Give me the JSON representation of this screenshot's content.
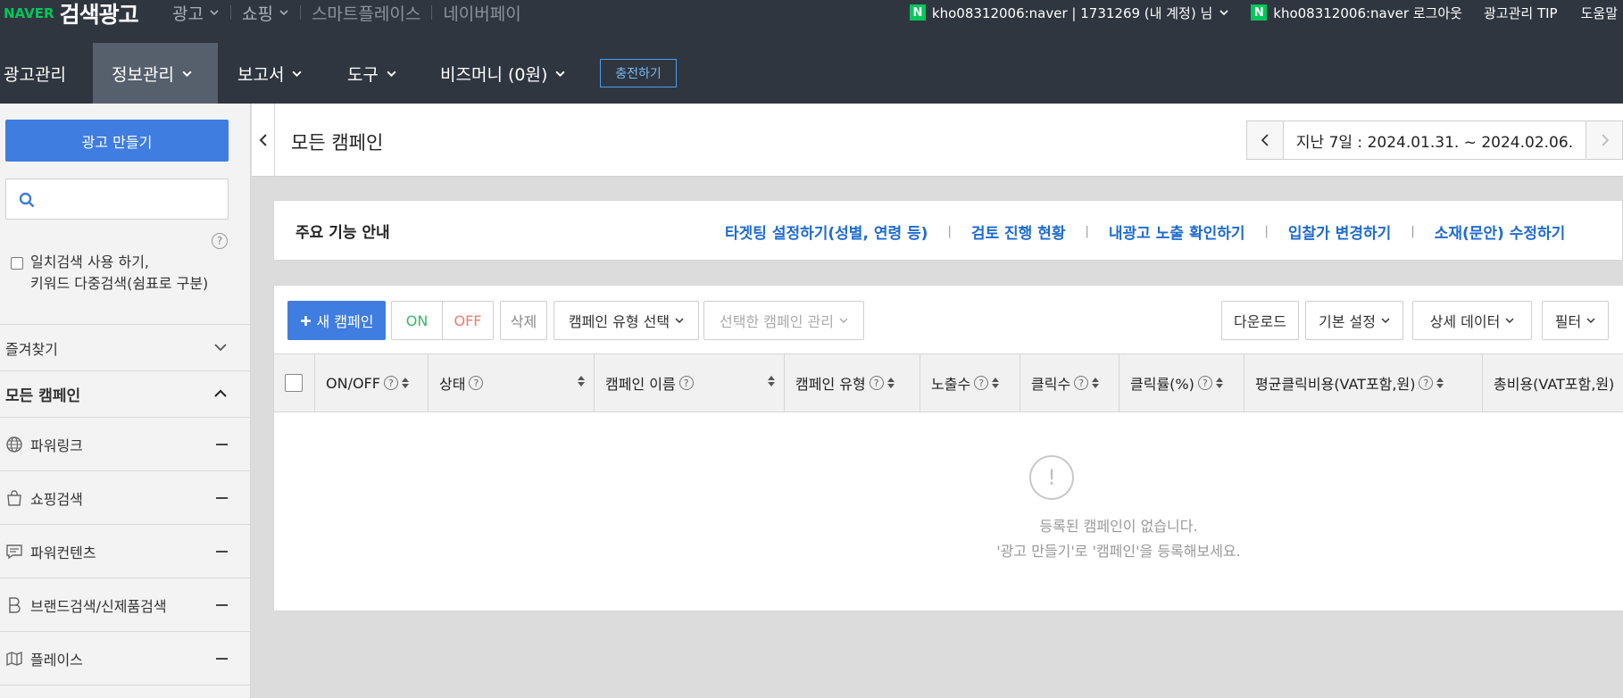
{
  "header": {
    "logo_naver": "NAVER",
    "logo_title": "검색광고",
    "nav": [
      {
        "label": "광고"
      },
      {
        "label": "쇼핑"
      },
      {
        "label": "스마트플레이스"
      },
      {
        "label": "네이버페이"
      }
    ],
    "account_label": "kho08312006:naver | 1731269 (내 계정) 님",
    "logout_label": "kho08312006:naver 로그아웃",
    "tip_label": "광고관리 TIP",
    "help_label": "도움말",
    "n_badge": "N",
    "brand_color": "#03c75a"
  },
  "secondnav": {
    "items": [
      {
        "label": "광고관리"
      },
      {
        "label": "정보관리"
      },
      {
        "label": "보고서"
      },
      {
        "label": "도구"
      },
      {
        "label": "비즈머니 (0원)"
      }
    ],
    "charge_label": "충전하기"
  },
  "sidebar": {
    "make_ad": "광고 만들기",
    "search_placeholder": "",
    "help": "?",
    "keyword_option_line1": "일치검색 사용 하기,",
    "keyword_option_line2": "키워드 다중검색(쉼표로 구분)",
    "favorites": "즐겨찾기",
    "all_campaigns": "모든 캠페인",
    "types": [
      {
        "label": "파워링크",
        "icon": "globe-icon"
      },
      {
        "label": "쇼핑검색",
        "icon": "shopping-bag-icon"
      },
      {
        "label": "파워컨텐츠",
        "icon": "chat-icon"
      },
      {
        "label": "브랜드검색/신제품검색",
        "icon": "brand-b-icon"
      },
      {
        "label": "플레이스",
        "icon": "map-icon"
      }
    ]
  },
  "main": {
    "title": "모든 캠페인",
    "date_range": "지난 7일 : 2024.01.31. ~ 2024.02.06.",
    "guide_title": "주요 기능 안내",
    "guide_links": [
      "타겟팅 설정하기(성별, 연령 등)",
      "검토 진행 현황",
      "내광고 노출 확인하기",
      "입찰가 변경하기",
      "소재(문안) 수정하기"
    ],
    "guide_sep": "|",
    "toolbar": {
      "new_campaign": "새 캠페인",
      "on": "ON",
      "off": "OFF",
      "delete": "삭제",
      "type_select": "캠페인 유형 선택",
      "manage_selected": "선택한 캠페인 관리",
      "download": "다운로드",
      "basic_setting": "기본 설정",
      "detail_data": "상세 데이터",
      "filter": "필터"
    },
    "columns": [
      "ON/OFF",
      "상태",
      "캠페인 이름",
      "캠페인 유형",
      "노출수",
      "클릭수",
      "클릭률(%)",
      "평균클릭비용(VAT포함,원)",
      "총비용(VAT포함,원)"
    ],
    "empty_icon": "!",
    "empty_line1": "등록된 캠페인이 없습니다.",
    "empty_line2": "'광고 만들기'로 '캠페인'을 등록해보세요."
  }
}
